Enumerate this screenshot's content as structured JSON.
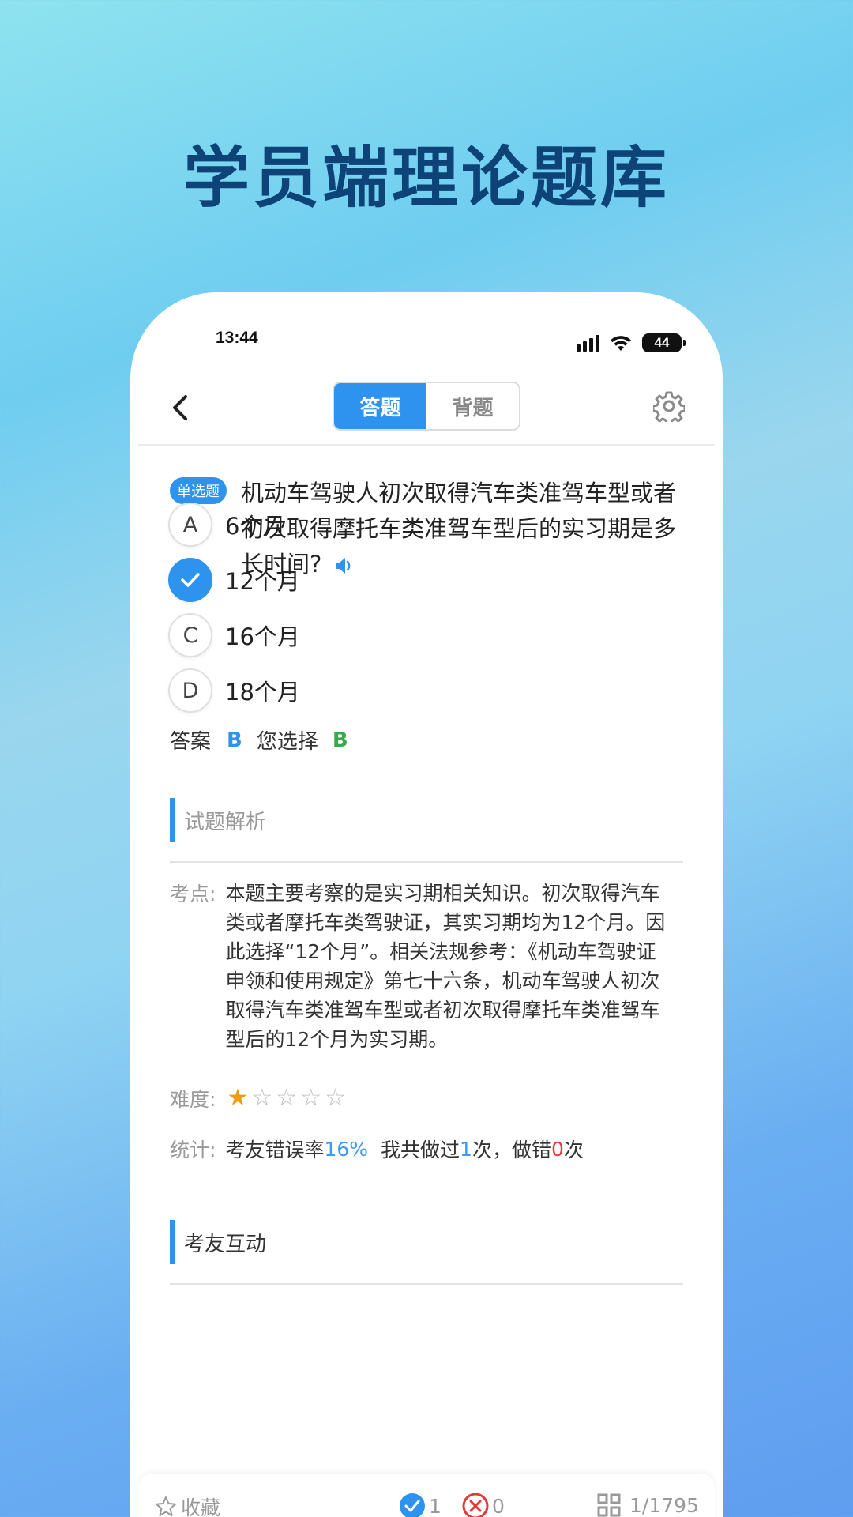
{
  "banner": {
    "title": "学员端理论题库"
  },
  "status": {
    "time": "13:44",
    "battery": "44"
  },
  "nav": {
    "tabs": [
      {
        "label": "答题",
        "active": true
      },
      {
        "label": "背题",
        "active": false
      }
    ]
  },
  "question": {
    "type_label": "单选题",
    "text": "机动车驾驶人初次取得汽车类准驾车型或者初次取得摩托车类准驾车型后的实习期是多长时间?",
    "options": [
      {
        "letter": "A",
        "text": "6个月",
        "selected": false
      },
      {
        "letter": "B",
        "text": "12个月",
        "selected": true
      },
      {
        "letter": "C",
        "text": "16个月",
        "selected": false
      },
      {
        "letter": "D",
        "text": "18个月",
        "selected": false
      }
    ]
  },
  "answer": {
    "label": "答案",
    "correct": "B",
    "choice_label": "您选择",
    "choice": "B"
  },
  "analysis": {
    "section_title": "试题解析",
    "point_label": "考点:",
    "point_text": "本题主要考察的是实习期相关知识。初次取得汽车类或者摩托车类驾驶证，其实习期均为12个月。因此选择“12个月”。相关法规参考：《机动车驾驶证申领和使用规定》第七十六条，机动车驾驶人初次取得汽车类准驾车型或者初次取得摩托车类准驾车型后的12个月为实习期。",
    "difficulty_label": "难度:",
    "difficulty": 1,
    "difficulty_max": 5,
    "stat_label": "统计:",
    "stat_prefix": "考友错误率",
    "error_rate": "16%",
    "stat_done_prefix": "我共做过",
    "done_count": "1",
    "stat_done_suffix": "次，做错",
    "wrong_count": "0",
    "stat_end": "次"
  },
  "community": {
    "section_title": "考友互动"
  },
  "bottom": {
    "favorite_label": "收藏",
    "correct_count": "1",
    "wrong_count": "0",
    "progress": "1/1795"
  },
  "colors": {
    "accent": "#2e93ee",
    "correct": "#3aa84a",
    "wrong": "#e53935",
    "star": "#f29a12"
  }
}
